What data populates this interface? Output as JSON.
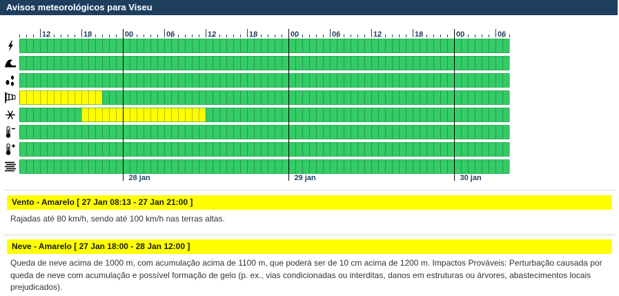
{
  "header": {
    "title": "Avisos meteorológicos para Viseu"
  },
  "timeline": {
    "hour_labels": [
      "12",
      "18",
      "00",
      "06",
      "12",
      "18",
      "00",
      "06",
      "12",
      "18",
      "00",
      "06"
    ],
    "date_labels": [
      "28 jan",
      "29 jan",
      "30 jan"
    ],
    "colors": {
      "green": "#33cc66",
      "yellow": "#ffff00",
      "grid": "#0a0a0a",
      "text": "#1e3e5e"
    },
    "rows": [
      {
        "icon": "lightning-icon",
        "name": "trovoada",
        "segments": []
      },
      {
        "icon": "wave-icon",
        "name": "agitacao-maritima",
        "segments": []
      },
      {
        "icon": "rain-drops-icon",
        "name": "precipitacao",
        "segments": []
      },
      {
        "icon": "wind-sock-icon",
        "name": "vento",
        "segments": [
          {
            "level": "yellow",
            "from_hour": 0,
            "to_hour": 12
          }
        ]
      },
      {
        "icon": "snowflake-icon",
        "name": "neve",
        "segments": [
          {
            "level": "yellow",
            "from_hour": 9,
            "to_hour": 27
          }
        ]
      },
      {
        "icon": "thermometer-cold-icon",
        "name": "tempo-frio",
        "segments": []
      },
      {
        "icon": "thermometer-hot-icon",
        "name": "tempo-quente",
        "segments": []
      },
      {
        "icon": "fog-icon",
        "name": "nevoeiro",
        "segments": []
      }
    ]
  },
  "warnings": [
    {
      "title": "Vento - Amarelo [ 27 Jan 08:13 - 27 Jan 21:00 ]",
      "description": "Rajadas até 80 km/h, sendo até 100 km/h nas terras altas."
    },
    {
      "title": "Neve - Amarelo [ 27 Jan 18:00 - 28 Jan 12:00 ]",
      "description": "Queda de neve acima de 1000 m, com acumulação acima de 1100 m, que poderá ser de 10 cm acima de 1200 m. Impactos Prováveis: Perturbação causada por queda de neve com acumulação e possível formação de gelo (p. ex., vias condicionadas ou interditas, danos em estruturas ou árvores, abastecimentos locais prejudicados)."
    }
  ]
}
